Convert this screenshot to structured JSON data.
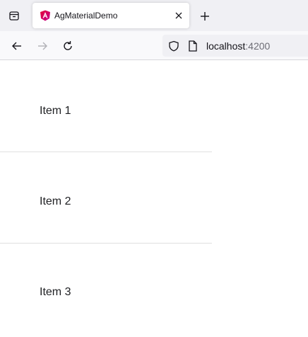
{
  "browser": {
    "tab": {
      "title": "AgMaterialDemo",
      "favicon": "angular-icon"
    },
    "url": {
      "host": "localhost",
      "port": ":4200"
    },
    "colors": {
      "tabstrip_bg": "#f0f0f4",
      "toolbar_bg": "#f9f9fb",
      "favicon_red": "#dd0031",
      "favicon_magenta": "#c3008f"
    }
  },
  "list": {
    "items": [
      {
        "label": "Item 1"
      },
      {
        "label": "Item 2"
      },
      {
        "label": "Item 3"
      }
    ]
  }
}
